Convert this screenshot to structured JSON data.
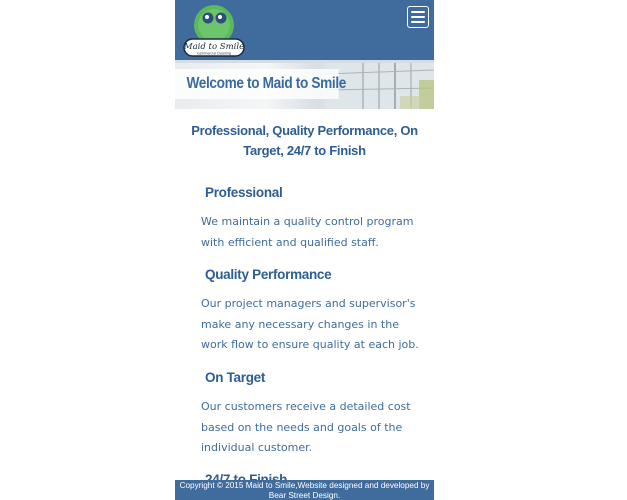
{
  "header": {
    "logo_text": "Maid to Smile",
    "logo_subtext": "Commercial Cleaning",
    "menu_icon": "hamburger-menu-icon"
  },
  "hero": {
    "title": "Welcome to Maid to Smile"
  },
  "main": {
    "tagline": "Professional, Quality Performance, On Target, 24/7 to Finish",
    "sections": [
      {
        "heading": "Professional",
        "text": "We maintain a quality control program with efficient and qualified staff."
      },
      {
        "heading": "Quality Performance",
        "text": "Our project managers and supervisor's make any necessary changes in the work flow to ensure quality at each job."
      },
      {
        "heading": "On Target",
        "text": "Our customers receive a detailed cost based on the needs and goals of the individual customer."
      },
      {
        "heading": "24/7 to Finish",
        "text": ""
      }
    ]
  },
  "footer": {
    "copyright": "Copyright © 2015 Maid to Smile,Website designed and developed by Bear Street Design."
  },
  "colors": {
    "brand_blue": "#3f6c9d",
    "heading_blue": "#2d5d92",
    "logo_green": "#5cb85c"
  }
}
